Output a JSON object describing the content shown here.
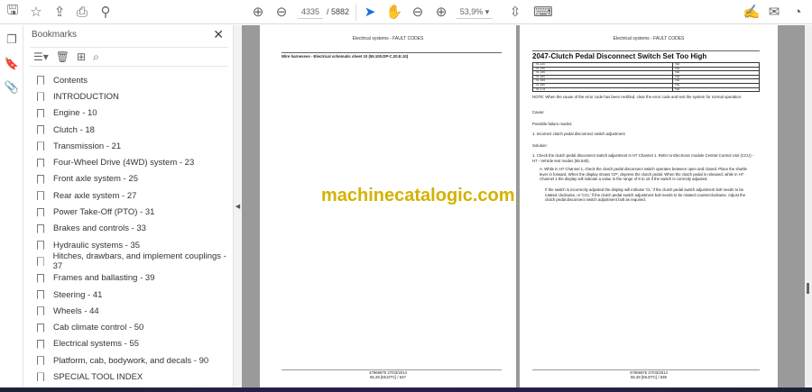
{
  "toolbar": {
    "page_current": "4335",
    "page_total": "/ 5882",
    "zoom": "53,9%",
    "zoom_caret": "▾"
  },
  "panel": {
    "title": "Bookmarks",
    "close": "✕",
    "items": [
      {
        "label": "Contents"
      },
      {
        "label": "INTRODUCTION"
      },
      {
        "label": "Engine - 10"
      },
      {
        "label": "Clutch - 18"
      },
      {
        "label": "Transmission - 21"
      },
      {
        "label": "Four-Wheel Drive (4WD) system - 23"
      },
      {
        "label": "Front axle system - 25"
      },
      {
        "label": "Rear axle system - 27"
      },
      {
        "label": "Power Take-Off (PTO) - 31"
      },
      {
        "label": "Brakes and controls - 33"
      },
      {
        "label": "Hydraulic systems - 35"
      },
      {
        "label": "Hitches, drawbars, and implement couplings - 37"
      },
      {
        "label": "Frames and ballasting - 39"
      },
      {
        "label": "Steering - 41"
      },
      {
        "label": "Wheels - 44"
      },
      {
        "label": "Cab climate control - 50"
      },
      {
        "label": "Electrical systems - 55"
      },
      {
        "label": "Platform, cab, bodywork, and decals - 90"
      },
      {
        "label": "SPECIAL TOOL INDEX"
      }
    ]
  },
  "left_page": {
    "header": "Electrical systems - FAULT CODES",
    "subtitle": "Wire harnesses - Electrical schematic sheet 10 (55.100.DP-C.20.E.10)",
    "footer_1": "47965975 27/03/2014",
    "footer_2": "55.28 [55.DTC] / 637"
  },
  "right_page": {
    "header": "Electrical systems - FAULT CODES",
    "title": "2047-Clutch Pedal Disconnect Switch Set Too High",
    "table": [
      [
        "T6.120",
        "NA"
      ],
      [
        "T6.140",
        "NA"
      ],
      [
        "T6.150",
        "NA"
      ],
      [
        "T6.160",
        "NA"
      ],
      [
        "T6.165",
        "NA"
      ],
      [
        "T6.180",
        "NA"
      ],
      [
        "T6.175",
        "NA"
      ]
    ],
    "note": "NOTE: When the cause of the error code has been rectified, clear the error code and test the system for normal operation.",
    "cause": "Cause:",
    "failure_modes": "Possible failure modes:",
    "failure_1": "1.  Incorrect clutch pedal disconnect switch adjustment",
    "solution": "Solution:",
    "step_1": "1.  Check the clutch pedal disconnect switch adjustment in H7 Channel 1.  Refer to Electronic module Central Control Unit (CCU) - H7 - Vehicle test modes (55.640).",
    "step_a": "A.  While in H7 Channel 1, check the clutch pedal disconnect switch operates between open and closed.  Place the shuttle lever in forward. When the display shows 'CP', depress the clutch pedal. When the clutch pedal is released, while in H7 Channel 1 the display will indicate a value in the range of 8 to 16 if the switch is correctly adjusted.",
    "step_a2": "If the switch is incorrectly adjusted the display will indicate 'CL' if the clutch pedal switch adjustment bolt needs to be rotated clockwise, or 'CCL' if the clutch pedal switch adjustment bolt needs to be rotated counterclockwise. Adjust the clutch pedal disconnect switch adjustment bolt as required.",
    "footer_1": "47965975 27/03/2014",
    "footer_2": "55.28 [55.DTC] / 638"
  },
  "watermark": "machinecatalogic.com"
}
